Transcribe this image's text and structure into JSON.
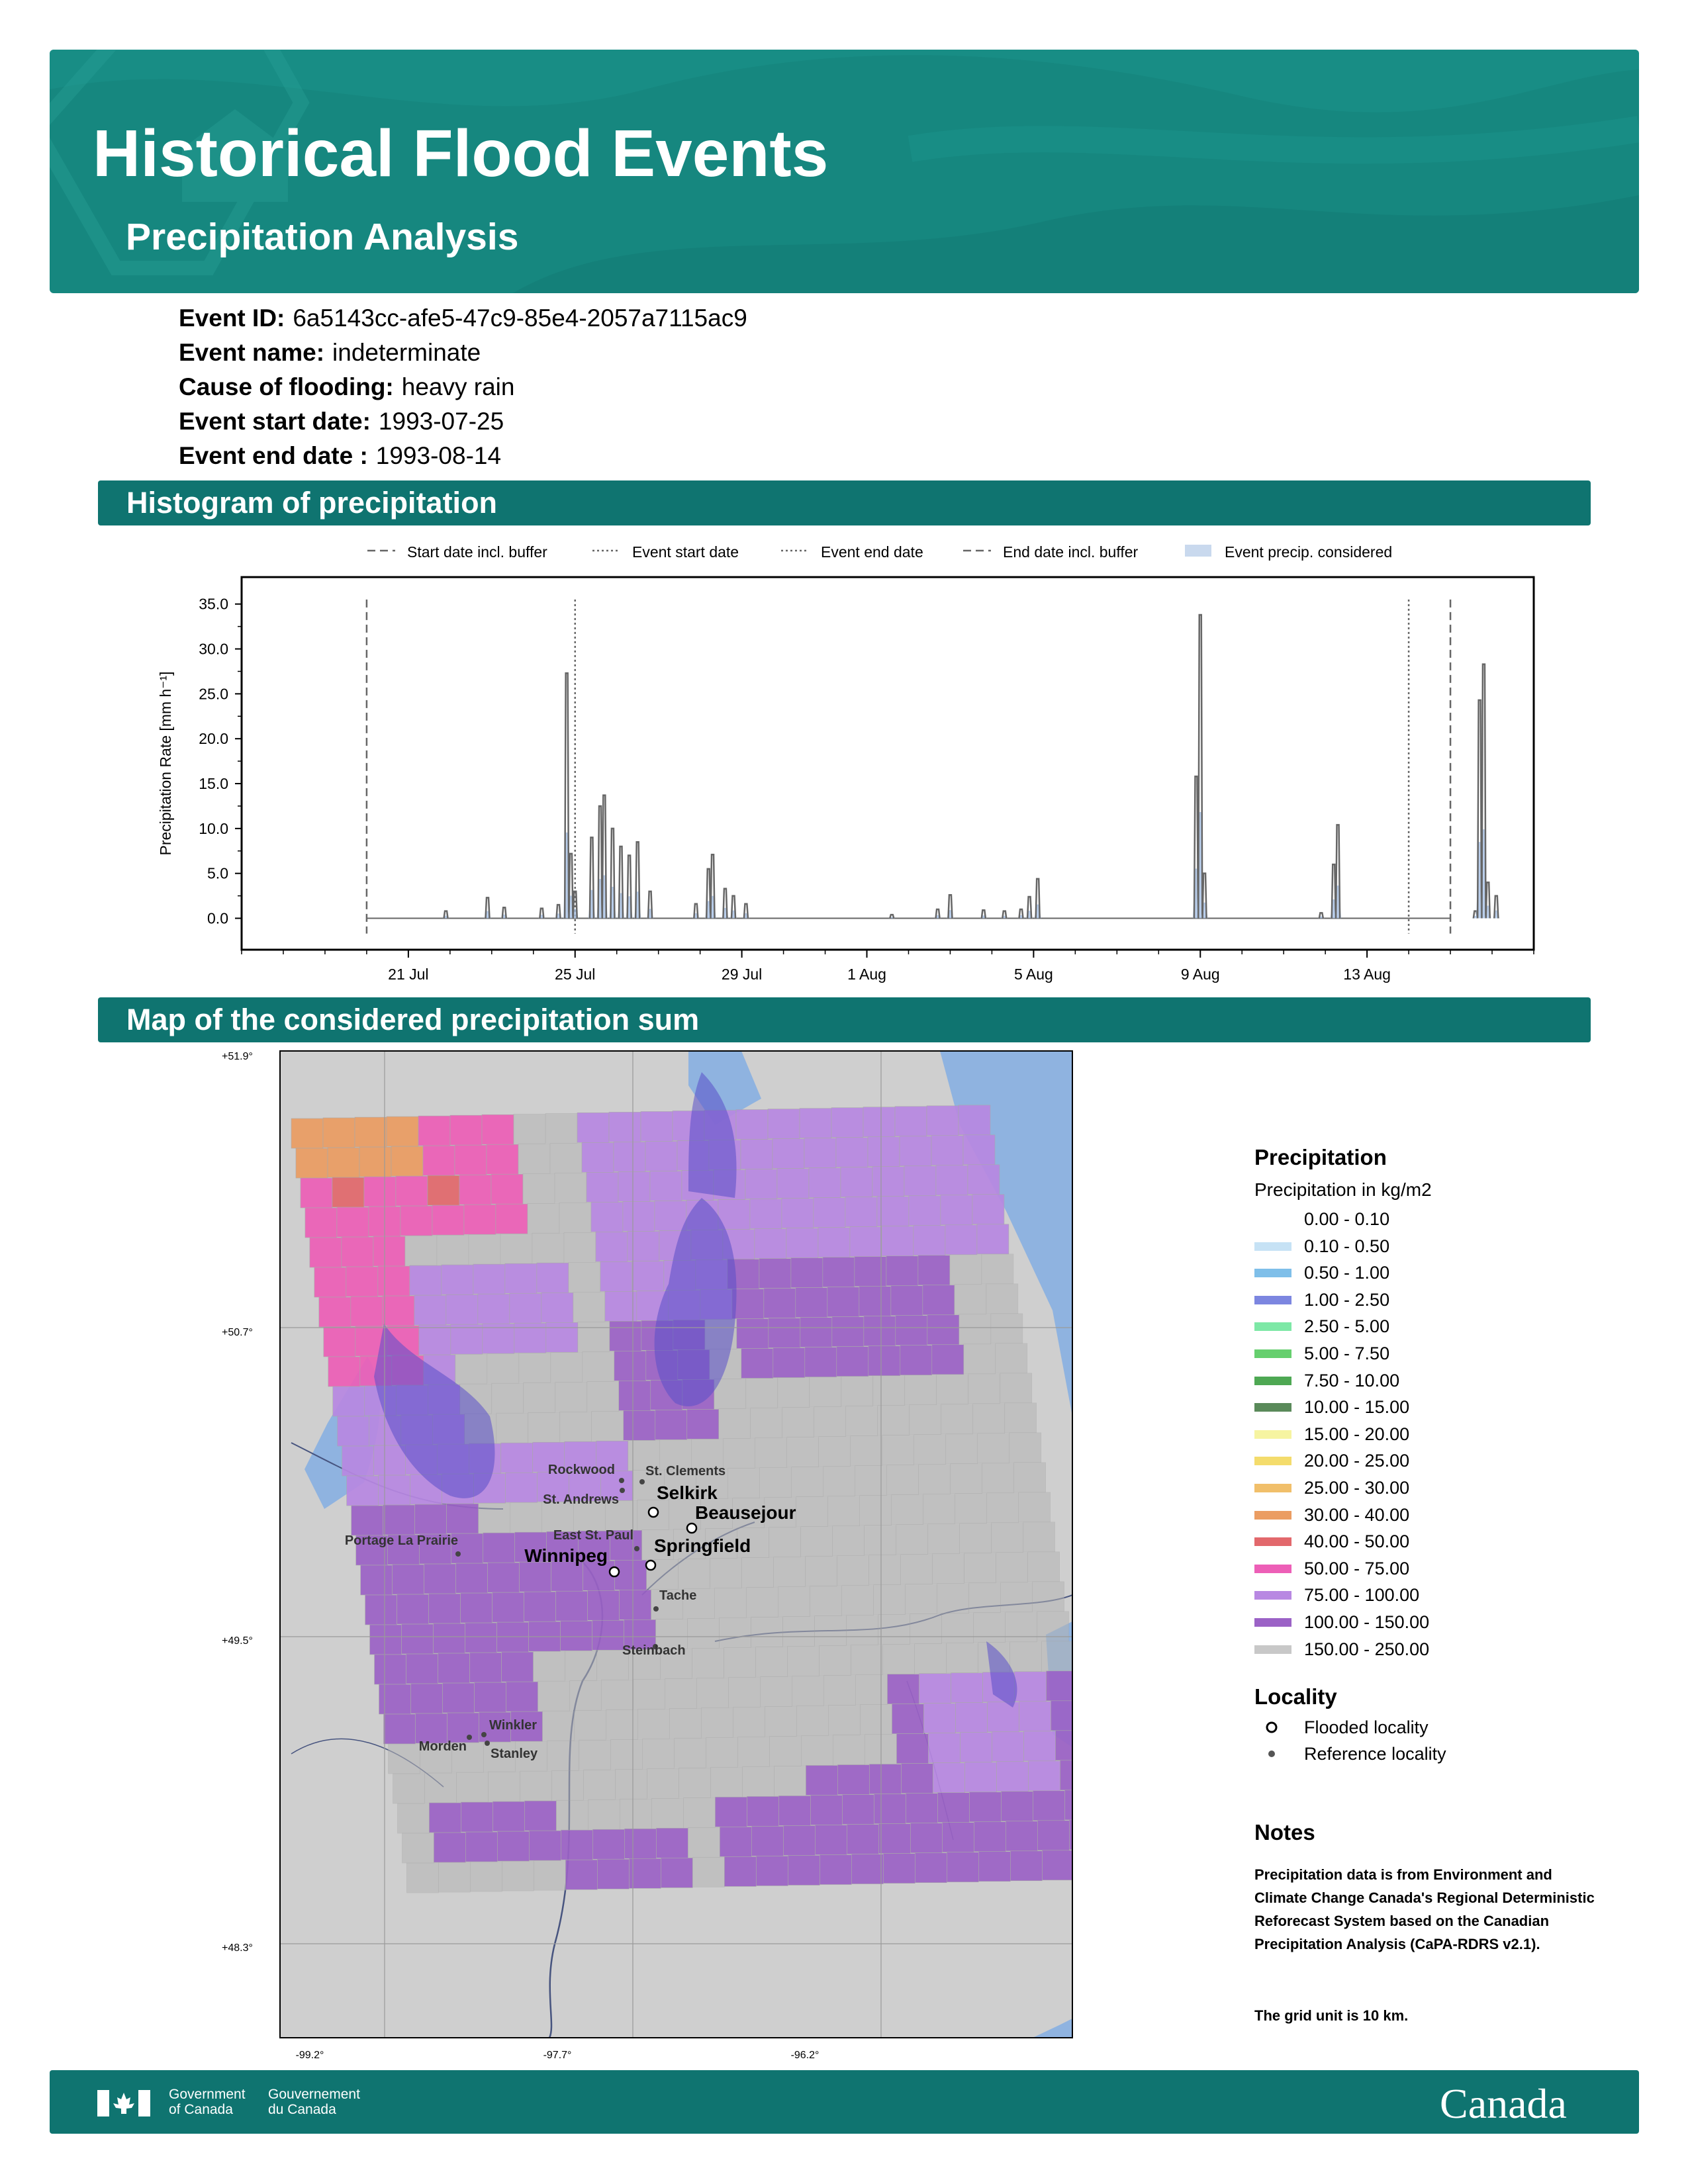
{
  "header": {
    "title": "Historical Flood Events",
    "subtitle": "Precipitation Analysis"
  },
  "event": {
    "id_label": "Event ID:",
    "id_value": "6a5143cc-afe5-47c9-85e4-2057a7115ac9",
    "name_label": "Event name:",
    "name_value": "indeterminate",
    "cause_label": "Cause of flooding:",
    "cause_value": "heavy rain",
    "start_label": "Event start date:",
    "start_value": "1993-07-25",
    "end_label": "Event end date :",
    "end_value": "1993-08-14"
  },
  "sections": {
    "histogram": "Histogram of precipitation",
    "map": "Map of the considered precipitation sum"
  },
  "chart_data": {
    "type": "line",
    "ylabel": "Precipitation Rate [mm h⁻¹]",
    "ylim": [
      0,
      35
    ],
    "yticks": [
      "0.0",
      "5.0",
      "10.0",
      "15.0",
      "20.0",
      "25.0",
      "30.0",
      "35.0"
    ],
    "xlim": [
      "1993-07-17",
      "1993-08-17"
    ],
    "xticks": [
      {
        "date": "1993-07-21",
        "label": "21 Jul"
      },
      {
        "date": "1993-07-25",
        "label": "25 Jul"
      },
      {
        "date": "1993-07-29",
        "label": "29 Jul"
      },
      {
        "date": "1993-08-01",
        "label": "1 Aug"
      },
      {
        "date": "1993-08-05",
        "label": "5 Aug"
      },
      {
        "date": "1993-08-09",
        "label": "9 Aug"
      },
      {
        "date": "1993-08-13",
        "label": "13 Aug"
      }
    ],
    "legend": [
      "Start date incl. buffer",
      "Event start date",
      "Event end date",
      "End date incl. buffer",
      "Event precip. considered"
    ],
    "legend_position": "top-center",
    "start_buffer_date": "1993-07-20",
    "event_start_date": "1993-07-25",
    "event_end_date": "1993-08-14",
    "end_buffer_date": "1993-08-15",
    "peaks": [
      {
        "date": "1993-07-21.9",
        "value": 0.8
      },
      {
        "date": "1993-07-22.9",
        "value": 2.3
      },
      {
        "date": "1993-07-23.3",
        "value": 1.2
      },
      {
        "date": "1993-07-24.2",
        "value": 1.1
      },
      {
        "date": "1993-07-24.6",
        "value": 1.5
      },
      {
        "date": "1993-07-24.8",
        "value": 27.3
      },
      {
        "date": "1993-07-24.9",
        "value": 7.2
      },
      {
        "date": "1993-07-25.0",
        "value": 3.0
      },
      {
        "date": "1993-07-25.4",
        "value": 9.0
      },
      {
        "date": "1993-07-25.6",
        "value": 12.5
      },
      {
        "date": "1993-07-25.7",
        "value": 13.7
      },
      {
        "date": "1993-07-25.9",
        "value": 10.0
      },
      {
        "date": "1993-07-26.1",
        "value": 8.0
      },
      {
        "date": "1993-07-26.3",
        "value": 7.0
      },
      {
        "date": "1993-07-26.5",
        "value": 8.5
      },
      {
        "date": "1993-07-26.8",
        "value": 3.0
      },
      {
        "date": "1993-07-27.9",
        "value": 1.6
      },
      {
        "date": "1993-07-28.2",
        "value": 5.5
      },
      {
        "date": "1993-07-28.3",
        "value": 7.1
      },
      {
        "date": "1993-07-28.6",
        "value": 3.3
      },
      {
        "date": "1993-07-28.8",
        "value": 2.5
      },
      {
        "date": "1993-07-29.1",
        "value": 1.6
      },
      {
        "date": "1993-08-01.6",
        "value": 0.4
      },
      {
        "date": "1993-08-02.7",
        "value": 1.0
      },
      {
        "date": "1993-08-03.0",
        "value": 2.6
      },
      {
        "date": "1993-08-03.8",
        "value": 0.9
      },
      {
        "date": "1993-08-04.3",
        "value": 0.8
      },
      {
        "date": "1993-08-04.7",
        "value": 1.0
      },
      {
        "date": "1993-08-04.9",
        "value": 2.4
      },
      {
        "date": "1993-08-05.1",
        "value": 4.4
      },
      {
        "date": "1993-08-08.9",
        "value": 15.8
      },
      {
        "date": "1993-08-09.0",
        "value": 33.8
      },
      {
        "date": "1993-08-09.1",
        "value": 5.0
      },
      {
        "date": "1993-08-11.9",
        "value": 0.6
      },
      {
        "date": "1993-08-12.2",
        "value": 6.0
      },
      {
        "date": "1993-08-12.3",
        "value": 10.4
      },
      {
        "date": "1993-08-15.6",
        "value": 0.8
      },
      {
        "date": "1993-08-15.7",
        "value": 24.3
      },
      {
        "date": "1993-08-15.8",
        "value": 28.3
      },
      {
        "date": "1993-08-15.9",
        "value": 4.0
      },
      {
        "date": "1993-08-16.1",
        "value": 2.5
      }
    ]
  },
  "map": {
    "lat_labels": [
      "+51.9°",
      "+50.7°",
      "+49.5°",
      "+48.3°"
    ],
    "lon_labels": [
      "-99.2°",
      "-97.7°",
      "-96.2°"
    ],
    "cities": [
      {
        "name": "Rockwood",
        "flooded": false
      },
      {
        "name": "St. Clements",
        "flooded": false
      },
      {
        "name": "St. Andrews",
        "flooded": false
      },
      {
        "name": "Selkirk",
        "flooded": true
      },
      {
        "name": "Beausejour",
        "flooded": true
      },
      {
        "name": "East St. Paul",
        "flooded": false
      },
      {
        "name": "Winnipeg",
        "flooded": true
      },
      {
        "name": "Springfield",
        "flooded": true
      },
      {
        "name": "Portage La Prairie",
        "flooded": false
      },
      {
        "name": "Tache",
        "flooded": false
      },
      {
        "name": "Steinbach",
        "flooded": false
      },
      {
        "name": "Winkler",
        "flooded": false
      },
      {
        "name": "Morden",
        "flooded": false
      },
      {
        "name": "Stanley",
        "flooded": false
      }
    ]
  },
  "legend": {
    "precip_title": "Precipitation",
    "precip_sub": "Precipitation in kg/m2",
    "classes": [
      {
        "label": "0.00 - 0.10",
        "color": "#ffffff"
      },
      {
        "label": "0.10 - 0.50",
        "color": "#c6e2f5"
      },
      {
        "label": "0.50 - 1.00",
        "color": "#7fbfe9"
      },
      {
        "label": "1.00 - 2.50",
        "color": "#7c86e0"
      },
      {
        "label": "2.50 - 5.00",
        "color": "#7de8a6"
      },
      {
        "label": "5.00 - 7.50",
        "color": "#66cf6e"
      },
      {
        "label": "7.50 - 10.00",
        "color": "#4ea853"
      },
      {
        "label": "10.00 - 15.00",
        "color": "#5a8a5a"
      },
      {
        "label": "15.00 - 20.00",
        "color": "#f6f4a1"
      },
      {
        "label": "20.00 - 25.00",
        "color": "#f4dc6c"
      },
      {
        "label": "25.00 - 30.00",
        "color": "#f1bf6a"
      },
      {
        "label": "30.00 - 40.00",
        "color": "#eb9d62"
      },
      {
        "label": "40.00 - 50.00",
        "color": "#e2686c"
      },
      {
        "label": "50.00 - 75.00",
        "color": "#ed5fb7"
      },
      {
        "label": "75.00 - 100.00",
        "color": "#b888e2"
      },
      {
        "label": "100.00 - 150.00",
        "color": "#9b62c6"
      },
      {
        "label": "150.00 - 250.00",
        "color": "#c8c8c8"
      }
    ],
    "locality_title": "Locality",
    "flooded_label": "Flooded locality",
    "reference_label": "Reference locality",
    "notes_title": "Notes",
    "note1": "Precipitation data is from Environment and Climate Change Canada's Regional Deterministic Reforecast System based on the Canadian Precipitation Analysis (CaPA-RDRS v2.1).",
    "note2": "The grid unit is 10 km."
  },
  "footer": {
    "gov_en_1": "Government",
    "gov_en_2": "of Canada",
    "gov_fr_1": "Gouvernement",
    "gov_fr_2": "du Canada",
    "wordmark": "Canada"
  }
}
